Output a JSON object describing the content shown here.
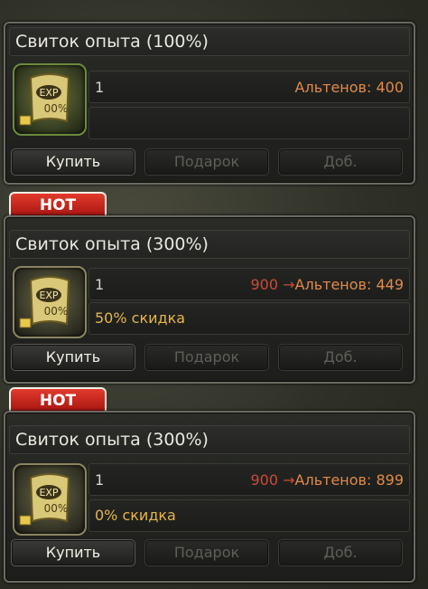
{
  "items": [
    {
      "hot_badge": "",
      "title": "Свиток опыта (100%)",
      "quantity": "1",
      "old_price": "",
      "arrow": "",
      "price": "Альтенов: 400",
      "discount": "",
      "buy_label": "Купить",
      "gift_label": "Подарок",
      "add_label": "Доб.",
      "icon": "exp-scroll-icon"
    },
    {
      "hot_badge": "HOT",
      "title": "Свиток опыта (300%)",
      "quantity": "1",
      "old_price": "900",
      "arrow": "→",
      "price": "Альтенов: 449",
      "discount": "50% скидка",
      "buy_label": "Купить",
      "gift_label": "Подарок",
      "add_label": "Доб.",
      "icon": "exp-scroll-icon"
    },
    {
      "hot_badge": "HOT",
      "title": "Свиток опыта (300%)",
      "quantity": "1",
      "old_price": "900",
      "arrow": "→",
      "price": "Альтенов: 899",
      "discount": "0% скидка",
      "buy_label": "Купить",
      "gift_label": "Подарок",
      "add_label": "Доб.",
      "icon": "exp-scroll-icon"
    }
  ],
  "colors": {
    "old_price": "#c94a3a",
    "currency": "#e08a4a",
    "discount": "#e5b64a",
    "hot_badge": "#d1261c"
  }
}
